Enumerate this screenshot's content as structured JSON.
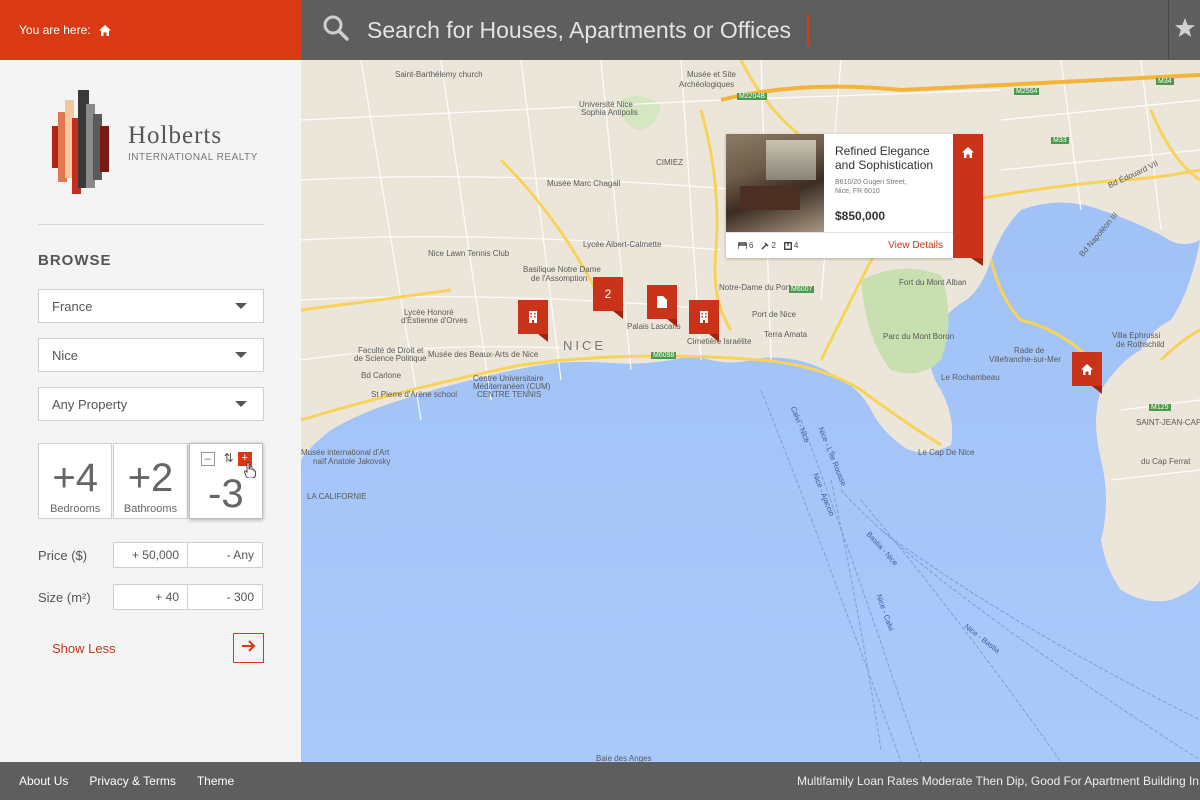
{
  "header": {
    "breadcrumb_label": "You are here:",
    "search_placeholder": "Search for Houses, Apartments or Offices"
  },
  "brand": {
    "name": "Holberts",
    "tagline": "INTERNATIONAL REALTY"
  },
  "sidebar": {
    "browse_title": "BROWSE",
    "country": "France",
    "city": "Nice",
    "property_type": "Any Property",
    "bedrooms": {
      "value": "+4",
      "label": "Bedrooms"
    },
    "bathrooms": {
      "value": "+2",
      "label": "Bathrooms"
    },
    "third_counter": {
      "value": "-3",
      "minus": "–",
      "swap": "⇅",
      "plus": "+"
    },
    "price": {
      "label": "Price ($)",
      "min": "+ 50,000",
      "max": "- Any"
    },
    "size": {
      "label": "Size (m²)",
      "min": "+ 40",
      "max": "- 300"
    },
    "show_less": "Show Less"
  },
  "map": {
    "labels": {
      "st_barthelemy": "Saint-Barthélemy church",
      "musee_site": "Musée et Site",
      "archeologiques": "Archéologiques",
      "universite": "Université Nice",
      "sophia": "Sophia Antipolis",
      "cimiez": "CIMIEZ",
      "chagall": "Musée Marc Chagall",
      "tennis": "Nice Lawn Tennis Club",
      "calmette": "Lycée Albert-Calmette",
      "basilique": "Basilique Notre Dame",
      "assomption": "de l'Assomption",
      "nice": "NICE",
      "lycee_honore": "Lycée Honoré",
      "estienne": "d'Estienne d'Orves",
      "faculte": "Faculté de Droit et",
      "science": "de Science Politique",
      "arts": "Musée des Beaux-Arts de Nice",
      "calrone": "Bd Carlone",
      "cum1": "Centre Universitaire",
      "cum2": "Méditerranéen (CUM)",
      "tennis_school": "CENTRE TENNIS",
      "st_pierre": "St Pierre d'Arène school",
      "musee_naif": "Musée international d'Art",
      "naif": "naïf Anatole Jakovsky",
      "californie": "LA CALIFORNIE",
      "ndport": "Notre-Dame du Port",
      "port": "Port de Nice",
      "terra": "Terra Amata",
      "palais": "Palais Lascaris",
      "cimetiere": "Cimetière Israélite",
      "fort": "Fort du Mont Alban",
      "parc": "Parc du Mont Boron",
      "capnice": "Le Cap De Nice",
      "rade": "Rade de",
      "villefranche": "Villefranche-sur-Mer",
      "ephrussi": "Villa Ephrussi",
      "rothschild": "de Rothschild",
      "stjean": "SAINT-JEAN-CAP",
      "ferrat": "du Cap Ferrat",
      "rochambeau": "Le Rochambeau",
      "baie": "Baie des Anges",
      "ferry1": "Calvi - Nice",
      "ferry2": "Nice - L'Île Rousse",
      "ferry3": "Nice - Ajaccio",
      "ferry4": "Bastia - Nice",
      "ferry5": "Nice - Calvi",
      "ferry6": "Nice - Bastia",
      "m2204b": "M2204B",
      "m2564": "M2564",
      "m6007": "M6007",
      "m6098": "M6098",
      "m33": "M33",
      "m34": "M34",
      "m125": "M125",
      "bd_edouard": "Bd Édouard VII",
      "bd_napoleon": "Bd Napoléon III"
    },
    "cluster_count": "2"
  },
  "popup": {
    "title": "Refined Elegance and Sophistication",
    "address_line1": "B610/20 Gugeri Street,",
    "address_line2": "Nice, FR 6010",
    "price": "$850,000",
    "beds": "6",
    "baths": "2",
    "rooms": "4",
    "view_details": "View Details"
  },
  "footer": {
    "about": "About Us",
    "privacy": "Privacy & Terms",
    "theme": "Theme",
    "ticker": "Multifamily Loan Rates Moderate Then Dip, Good For Apartment Building In"
  },
  "colors": {
    "accent": "#d93a14",
    "topbar": "#5e5e5e",
    "sea": "#a8c8f8",
    "land": "#ece6da"
  }
}
